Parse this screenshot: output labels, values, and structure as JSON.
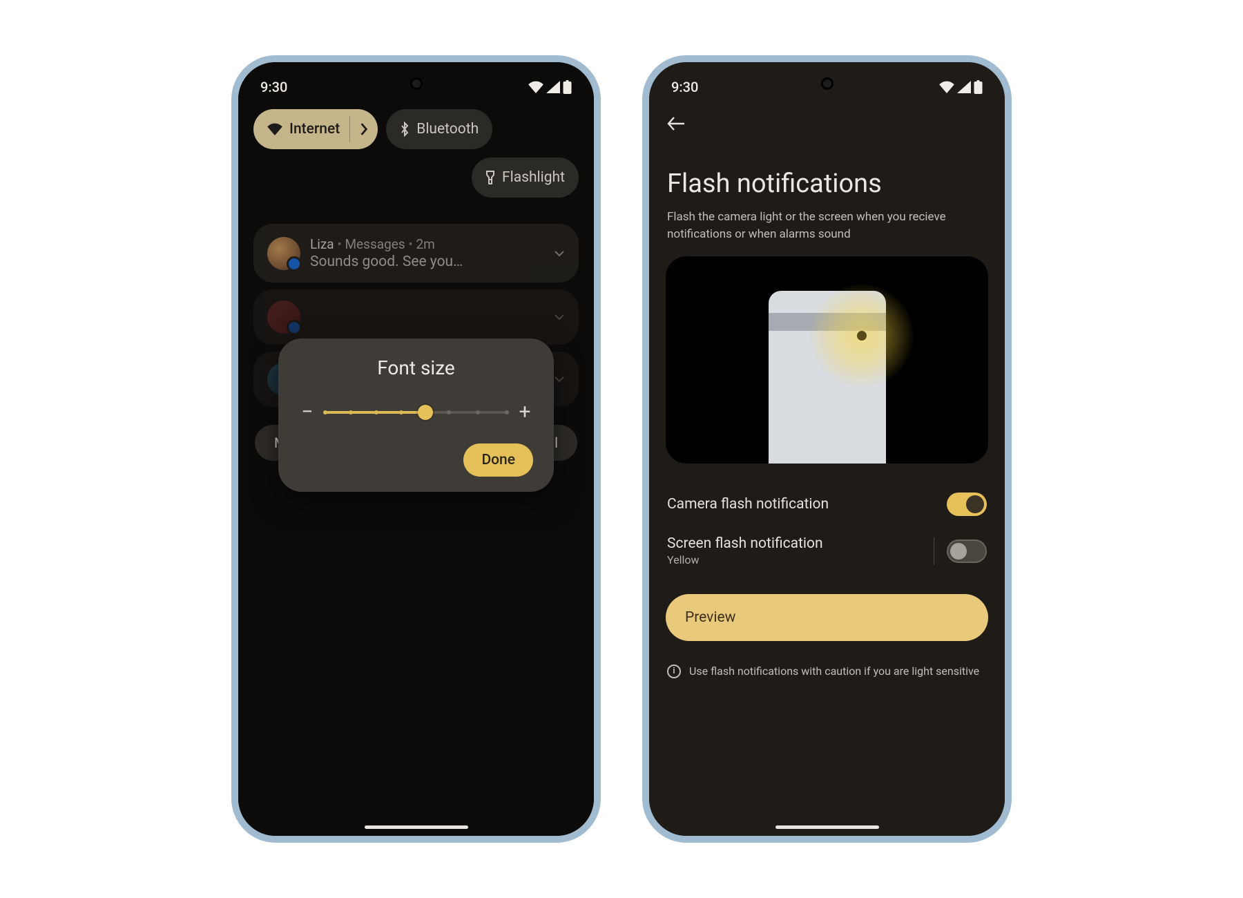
{
  "status": {
    "time": "9:30"
  },
  "phone1": {
    "qs": {
      "internet": "Internet",
      "bluetooth": "Bluetooth",
      "flashlight": "Flashlight"
    },
    "notif": {
      "name": "Liza",
      "app": "Messages",
      "age": "2m",
      "body": "Sounds good. See you…"
    },
    "actions": {
      "manage": "Manage",
      "clear": "Clear All"
    },
    "dialog": {
      "title": "Font size",
      "done": "Done"
    }
  },
  "phone2": {
    "title": "Flash notifications",
    "subtitle": "Flash the camera light or the screen when you recieve notifications or when alarms sound",
    "camera": {
      "label": "Camera flash notification"
    },
    "screen": {
      "label": "Screen flash notification",
      "value": "Yellow"
    },
    "preview": "Preview",
    "caution": "Use flash notifications with caution if you are light sensitive"
  }
}
